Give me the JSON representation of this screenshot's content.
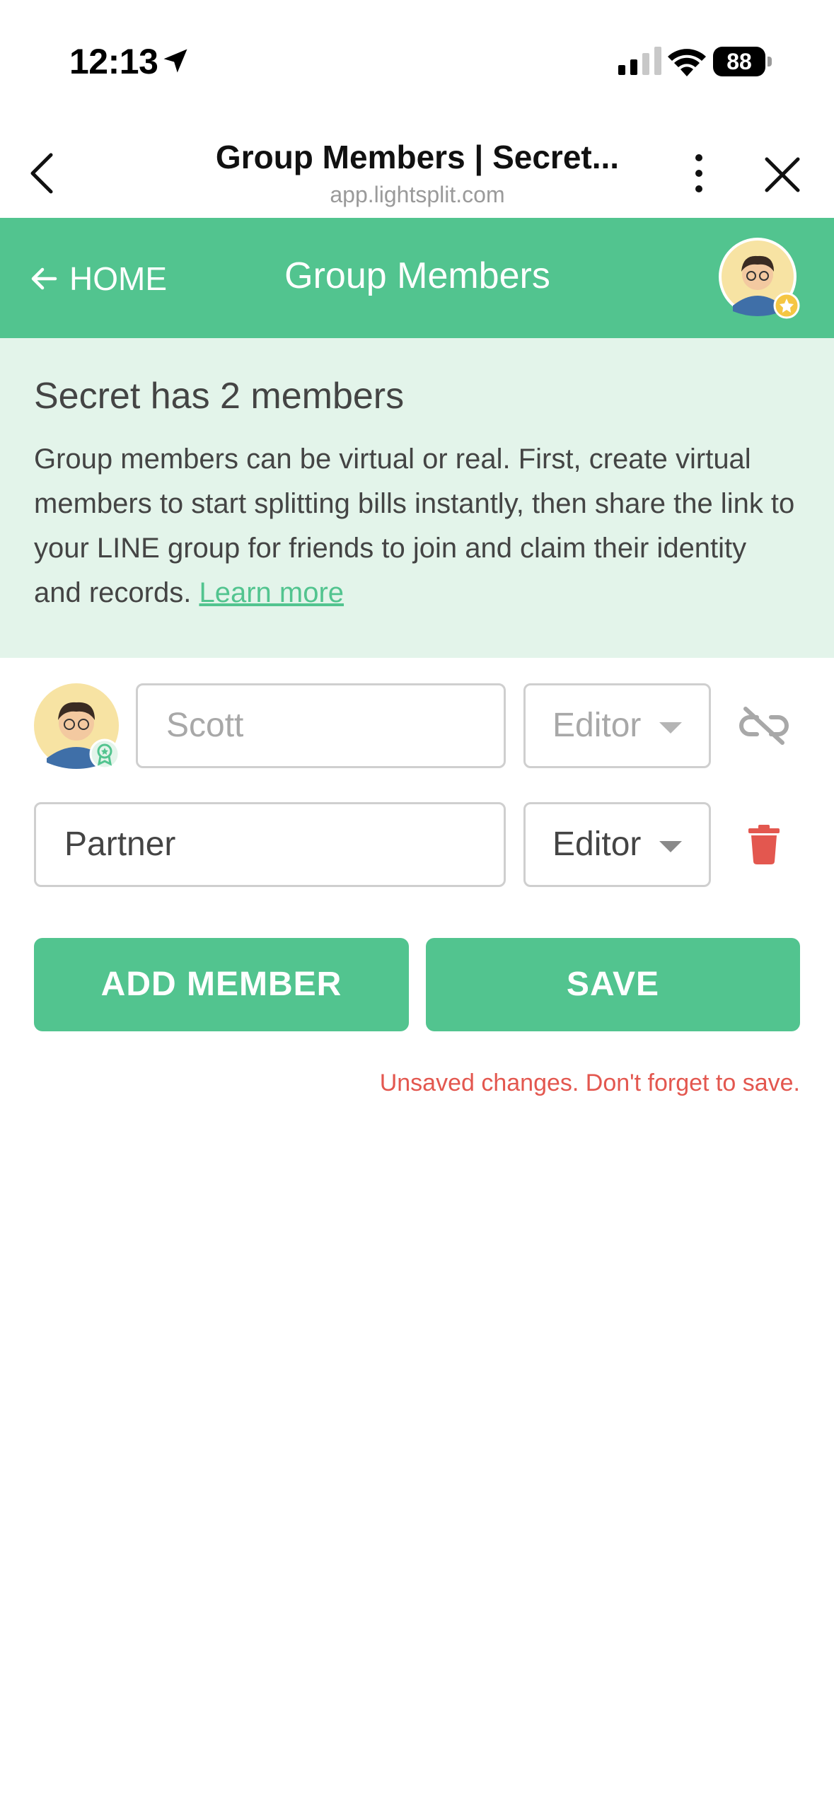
{
  "status_bar": {
    "time": "12:13",
    "battery": "88"
  },
  "browser": {
    "title": "Group Members | Secret...",
    "url": "app.lightsplit.com"
  },
  "header": {
    "home_label": "HOME",
    "title": "Group Members"
  },
  "info": {
    "heading": "Secret has 2 members",
    "body": "Group members can be virtual or real. First, create virtual members to start splitting bills instantly, then share the link to your LINE group for friends to join and claim their identity and records. ",
    "learn_more": "Learn more"
  },
  "members": [
    {
      "name_placeholder": "Scott",
      "role": "Editor",
      "linked": true,
      "action_icon": "unlink-icon"
    },
    {
      "name_value": "Partner",
      "role": "Editor",
      "linked": false,
      "action_icon": "trash-icon"
    }
  ],
  "actions": {
    "add_member": "ADD MEMBER",
    "save": "SAVE"
  },
  "warning": "Unsaved changes. Don't forget to save.",
  "colors": {
    "brand_green": "#52c48f",
    "info_bg": "#e3f4ea",
    "danger": "#e3574f"
  }
}
